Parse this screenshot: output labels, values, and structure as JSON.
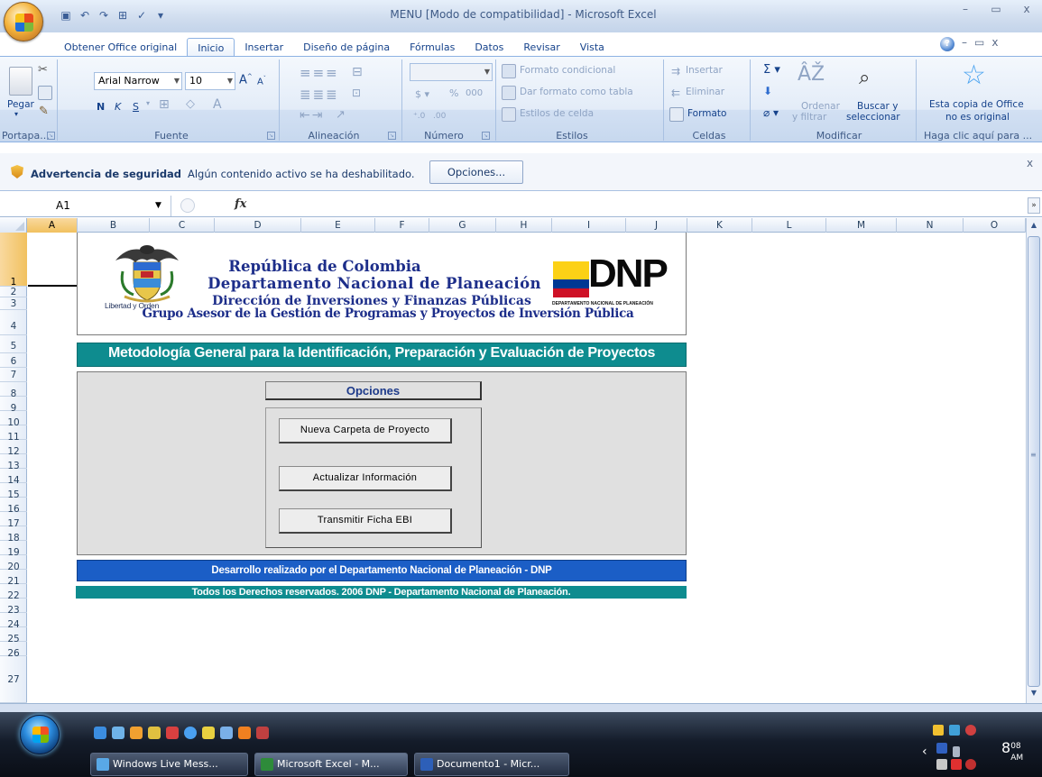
{
  "window": {
    "title": "MENU  [Modo de compatibilidad] - Microsoft Excel",
    "controls": [
      "–",
      "▭",
      "x"
    ]
  },
  "ribbon_tabs": [
    "Obtener Office original",
    "Inicio",
    "Insertar",
    "Diseño de página",
    "Fórmulas",
    "Datos",
    "Revisar",
    "Vista"
  ],
  "ribbon": {
    "clipboard": {
      "paste": "Pegar",
      "label": "Portapa..."
    },
    "font": {
      "name": "Arial Narrow",
      "size": "10",
      "bold": "N",
      "italic": "K",
      "underline": "S",
      "label": "Fuente"
    },
    "alignment": {
      "label": "Alineación"
    },
    "number": {
      "format": "",
      "percent": "%",
      "thousands": "000",
      "label": "Número"
    },
    "styles": {
      "conditional": "Formato condicional",
      "as_table": "Dar formato como tabla",
      "cell_styles": "Estilos de celda",
      "label": "Estilos"
    },
    "cells": {
      "insert": "Insertar",
      "delete": "Eliminar",
      "format": "Formato",
      "label": "Celdas"
    },
    "editing": {
      "sort_line1": "Ordenar",
      "sort_line2": "y filtrar",
      "find_line1": "Buscar y",
      "find_line2": "seleccionar",
      "label": "Modificar"
    },
    "office": {
      "line1": "Esta copia de Office",
      "line2": "no es original",
      "label": "Haga clic aquí para ..."
    }
  },
  "security": {
    "title": "Advertencia de seguridad",
    "message": "Algún contenido activo se ha deshabilitado.",
    "button": "Opciones..."
  },
  "formula_bar": {
    "cell_ref": "A1",
    "fx": "fx",
    "value": ""
  },
  "columns": [
    "A",
    "B",
    "C",
    "D",
    "E",
    "F",
    "G",
    "H",
    "I",
    "J",
    "K",
    "L",
    "M",
    "N",
    "O"
  ],
  "rows": [
    "1",
    "2",
    "3",
    "4",
    "5",
    "6",
    "7",
    "8",
    "9",
    "10",
    "11",
    "12",
    "13",
    "14",
    "15",
    "16",
    "17",
    "18",
    "19",
    "20",
    "21",
    "22",
    "23",
    "24",
    "25",
    "26",
    "27"
  ],
  "sheet": {
    "header": {
      "line1": "República de Colombia",
      "line2": "Departamento Nacional de Planeación",
      "line3": "Dirección de Inversiones y Finanzas Públicas",
      "line4": "Grupo Asesor de la Gestión de Programas y Proyectos de Inversión Pública",
      "motto": "Libertad y Orden",
      "logo_text": "DNP",
      "logo_sub": "DEPARTAMENTO NACIONAL DE PLANEACIÓN"
    },
    "methodology": "Metodología General para la Identificación, Preparación y Evaluación de Proyectos",
    "options_title": "Opciones",
    "buttons": {
      "new_folder": "Nueva Carpeta de Proyecto",
      "update": "Actualizar Información",
      "transmit": "Transmitir Ficha EBI"
    },
    "footer1": "Desarrollo realizado por el Departamento Nacional de Planeación - DNP",
    "footer2": "Todos los Derechos reservados. 2006 DNP - Departamento Nacional de Planeación."
  },
  "taskbar": {
    "tasks": [
      "Windows Live Mess...",
      "Microsoft Excel - M...",
      "Documento1 - Micr..."
    ],
    "clock": "8",
    "clock_min": "08",
    "clock_ampm": "AM"
  }
}
